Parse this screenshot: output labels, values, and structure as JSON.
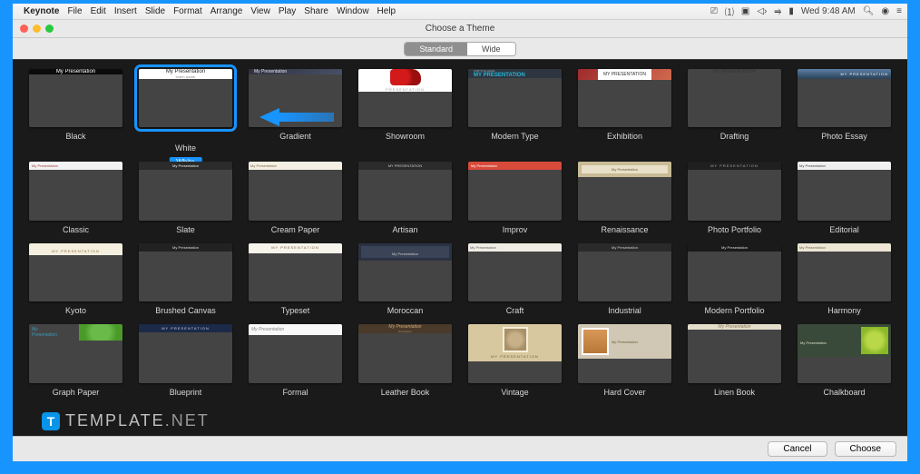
{
  "menubar": {
    "app": "Keynote",
    "items": [
      "File",
      "Edit",
      "Insert",
      "Slide",
      "Format",
      "Arrange",
      "View",
      "Play",
      "Share",
      "Window",
      "Help"
    ],
    "clock": "Wed 9:48 AM"
  },
  "window": {
    "title": "Choose a Theme",
    "segments": {
      "standard": "Standard",
      "wide": "Wide"
    },
    "selected_badge": "White",
    "buttons": {
      "cancel": "Cancel",
      "choose": "Choose"
    }
  },
  "themes": [
    {
      "key": "black",
      "label": "Black",
      "thumb_text": "My Presentation"
    },
    {
      "key": "white",
      "label": "White",
      "thumb_text": "My Presentation",
      "thumb_sub": "lorem ipsum"
    },
    {
      "key": "gradient",
      "label": "Gradient",
      "thumb_text": "My Presentation"
    },
    {
      "key": "showroom",
      "label": "Showroom",
      "thumb_text": "PRESENTATION"
    },
    {
      "key": "modern",
      "label": "Modern Type",
      "thumb_text": "MY PRESENTATION",
      "thumb_sub": "SUBTITLE HERE"
    },
    {
      "key": "exhib",
      "label": "Exhibition",
      "thumb_text": "MY PRESENTATION"
    },
    {
      "key": "draft",
      "label": "Drafting",
      "thumb_text": "MY PRESENTATION"
    },
    {
      "key": "photo",
      "label": "Photo Essay",
      "thumb_text": "MY PRESENTATION"
    },
    {
      "key": "classic",
      "label": "Classic",
      "thumb_text": "My Presentation"
    },
    {
      "key": "slate",
      "label": "Slate",
      "thumb_text": "My Presentation"
    },
    {
      "key": "cream",
      "label": "Cream Paper",
      "thumb_text": "My Presentation"
    },
    {
      "key": "artisan",
      "label": "Artisan",
      "thumb_text": "MY PRESENTATION"
    },
    {
      "key": "improv",
      "label": "Improv",
      "thumb_text": "My Presentation"
    },
    {
      "key": "renais",
      "label": "Renaissance",
      "thumb_text": "My Presentation"
    },
    {
      "key": "portf",
      "label": "Photo Portfolio",
      "thumb_text": "MY PRESENTATION"
    },
    {
      "key": "edit",
      "label": "Editorial",
      "thumb_text": "My Presentation"
    },
    {
      "key": "kyoto",
      "label": "Kyoto",
      "thumb_text": "MY PRESENTATION"
    },
    {
      "key": "brush",
      "label": "Brushed Canvas",
      "thumb_text": "My Presentation"
    },
    {
      "key": "typeset",
      "label": "Typeset",
      "thumb_text": "MY PRESENTATION"
    },
    {
      "key": "moroc",
      "label": "Moroccan",
      "thumb_text": "My Presentation"
    },
    {
      "key": "craft",
      "label": "Craft",
      "thumb_text": "My Presentation"
    },
    {
      "key": "indust",
      "label": "Industrial",
      "thumb_text": "My Presentation"
    },
    {
      "key": "mport",
      "label": "Modern Portfolio",
      "thumb_text": "My Presentation"
    },
    {
      "key": "harm",
      "label": "Harmony",
      "thumb_text": "My Presentation"
    },
    {
      "key": "graph",
      "label": "Graph Paper",
      "thumb_text": "My Presentation"
    },
    {
      "key": "blue",
      "label": "Blueprint",
      "thumb_text": "MY PRESENTATION"
    },
    {
      "key": "formal",
      "label": "Formal",
      "thumb_text": "My Presentation"
    },
    {
      "key": "leather",
      "label": "Leather Book",
      "thumb_text": "My Presentation",
      "thumb_sub": "Description"
    },
    {
      "key": "vintage",
      "label": "Vintage",
      "thumb_text": "MY PRESENTATION"
    },
    {
      "key": "hard",
      "label": "Hard Cover",
      "thumb_text": "My Presentation"
    },
    {
      "key": "linen",
      "label": "Linen Book",
      "thumb_text": "My Presentation"
    },
    {
      "key": "chalk",
      "label": "Chalkboard",
      "thumb_text": "My Presentation"
    }
  ],
  "selected_theme": "white",
  "watermark": {
    "prefix": "TEMPLATE",
    "suffix": ".NET"
  }
}
